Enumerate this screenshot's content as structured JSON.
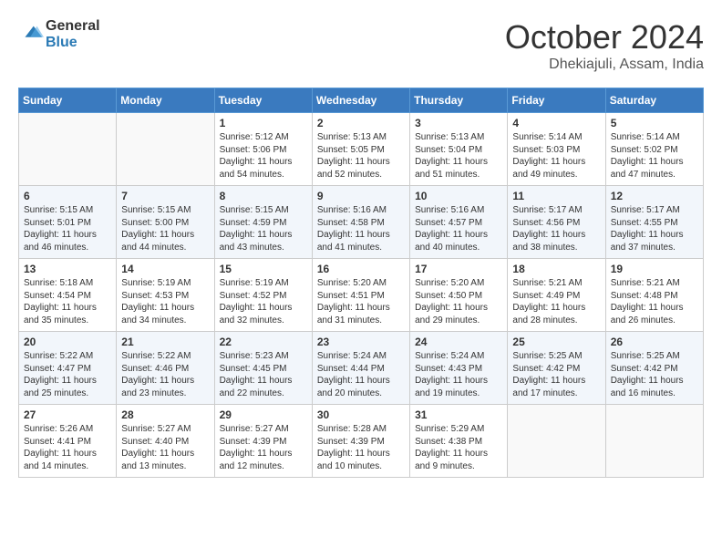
{
  "header": {
    "logo_general": "General",
    "logo_blue": "Blue",
    "month": "October 2024",
    "location": "Dhekiajuli, Assam, India"
  },
  "days_of_week": [
    "Sunday",
    "Monday",
    "Tuesday",
    "Wednesday",
    "Thursday",
    "Friday",
    "Saturday"
  ],
  "weeks": [
    [
      {
        "day": "",
        "empty": true
      },
      {
        "day": "",
        "empty": true
      },
      {
        "day": "1",
        "sunrise": "5:12 AM",
        "sunset": "5:06 PM",
        "daylight": "11 hours and 54 minutes."
      },
      {
        "day": "2",
        "sunrise": "5:13 AM",
        "sunset": "5:05 PM",
        "daylight": "11 hours and 52 minutes."
      },
      {
        "day": "3",
        "sunrise": "5:13 AM",
        "sunset": "5:04 PM",
        "daylight": "11 hours and 51 minutes."
      },
      {
        "day": "4",
        "sunrise": "5:14 AM",
        "sunset": "5:03 PM",
        "daylight": "11 hours and 49 minutes."
      },
      {
        "day": "5",
        "sunrise": "5:14 AM",
        "sunset": "5:02 PM",
        "daylight": "11 hours and 47 minutes."
      }
    ],
    [
      {
        "day": "6",
        "sunrise": "5:15 AM",
        "sunset": "5:01 PM",
        "daylight": "11 hours and 46 minutes."
      },
      {
        "day": "7",
        "sunrise": "5:15 AM",
        "sunset": "5:00 PM",
        "daylight": "11 hours and 44 minutes."
      },
      {
        "day": "8",
        "sunrise": "5:15 AM",
        "sunset": "4:59 PM",
        "daylight": "11 hours and 43 minutes."
      },
      {
        "day": "9",
        "sunrise": "5:16 AM",
        "sunset": "4:58 PM",
        "daylight": "11 hours and 41 minutes."
      },
      {
        "day": "10",
        "sunrise": "5:16 AM",
        "sunset": "4:57 PM",
        "daylight": "11 hours and 40 minutes."
      },
      {
        "day": "11",
        "sunrise": "5:17 AM",
        "sunset": "4:56 PM",
        "daylight": "11 hours and 38 minutes."
      },
      {
        "day": "12",
        "sunrise": "5:17 AM",
        "sunset": "4:55 PM",
        "daylight": "11 hours and 37 minutes."
      }
    ],
    [
      {
        "day": "13",
        "sunrise": "5:18 AM",
        "sunset": "4:54 PM",
        "daylight": "11 hours and 35 minutes."
      },
      {
        "day": "14",
        "sunrise": "5:19 AM",
        "sunset": "4:53 PM",
        "daylight": "11 hours and 34 minutes."
      },
      {
        "day": "15",
        "sunrise": "5:19 AM",
        "sunset": "4:52 PM",
        "daylight": "11 hours and 32 minutes."
      },
      {
        "day": "16",
        "sunrise": "5:20 AM",
        "sunset": "4:51 PM",
        "daylight": "11 hours and 31 minutes."
      },
      {
        "day": "17",
        "sunrise": "5:20 AM",
        "sunset": "4:50 PM",
        "daylight": "11 hours and 29 minutes."
      },
      {
        "day": "18",
        "sunrise": "5:21 AM",
        "sunset": "4:49 PM",
        "daylight": "11 hours and 28 minutes."
      },
      {
        "day": "19",
        "sunrise": "5:21 AM",
        "sunset": "4:48 PM",
        "daylight": "11 hours and 26 minutes."
      }
    ],
    [
      {
        "day": "20",
        "sunrise": "5:22 AM",
        "sunset": "4:47 PM",
        "daylight": "11 hours and 25 minutes."
      },
      {
        "day": "21",
        "sunrise": "5:22 AM",
        "sunset": "4:46 PM",
        "daylight": "11 hours and 23 minutes."
      },
      {
        "day": "22",
        "sunrise": "5:23 AM",
        "sunset": "4:45 PM",
        "daylight": "11 hours and 22 minutes."
      },
      {
        "day": "23",
        "sunrise": "5:24 AM",
        "sunset": "4:44 PM",
        "daylight": "11 hours and 20 minutes."
      },
      {
        "day": "24",
        "sunrise": "5:24 AM",
        "sunset": "4:43 PM",
        "daylight": "11 hours and 19 minutes."
      },
      {
        "day": "25",
        "sunrise": "5:25 AM",
        "sunset": "4:42 PM",
        "daylight": "11 hours and 17 minutes."
      },
      {
        "day": "26",
        "sunrise": "5:25 AM",
        "sunset": "4:42 PM",
        "daylight": "11 hours and 16 minutes."
      }
    ],
    [
      {
        "day": "27",
        "sunrise": "5:26 AM",
        "sunset": "4:41 PM",
        "daylight": "11 hours and 14 minutes."
      },
      {
        "day": "28",
        "sunrise": "5:27 AM",
        "sunset": "4:40 PM",
        "daylight": "11 hours and 13 minutes."
      },
      {
        "day": "29",
        "sunrise": "5:27 AM",
        "sunset": "4:39 PM",
        "daylight": "11 hours and 12 minutes."
      },
      {
        "day": "30",
        "sunrise": "5:28 AM",
        "sunset": "4:39 PM",
        "daylight": "11 hours and 10 minutes."
      },
      {
        "day": "31",
        "sunrise": "5:29 AM",
        "sunset": "4:38 PM",
        "daylight": "11 hours and 9 minutes."
      },
      {
        "day": "",
        "empty": true
      },
      {
        "day": "",
        "empty": true
      }
    ]
  ]
}
